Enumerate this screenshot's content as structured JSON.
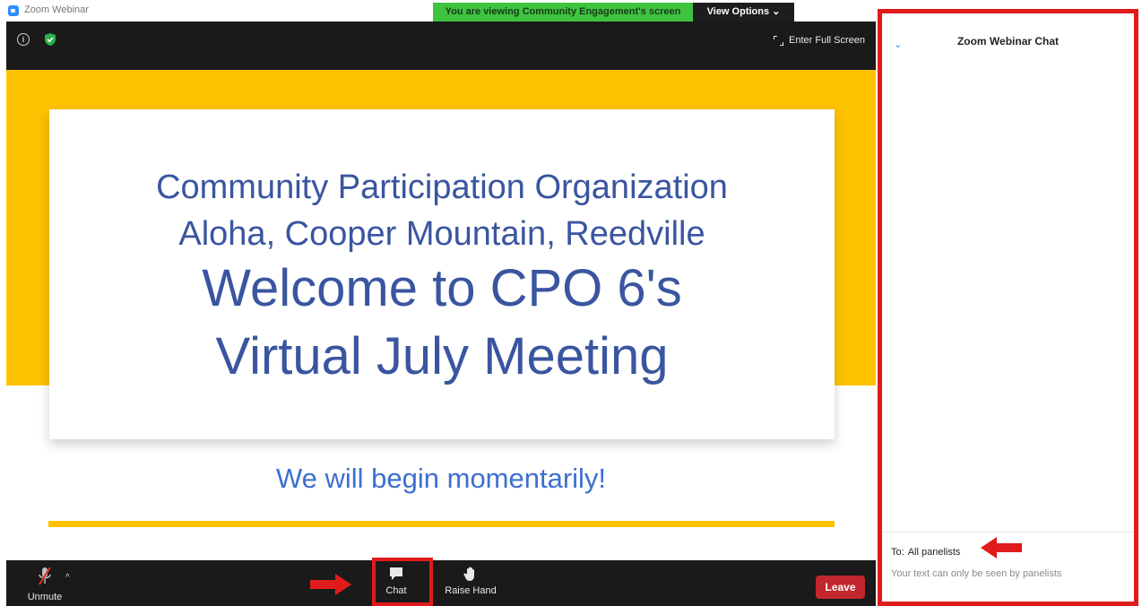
{
  "window": {
    "title": "Zoom Webinar"
  },
  "share": {
    "banner_text": "You are viewing Community Engagement's screen",
    "view_options": "View Options ⌄"
  },
  "video": {
    "fullscreen_label": "Enter Full Screen"
  },
  "slide": {
    "line1": "Community Participation Organization",
    "line2": "Aloha, Cooper Mountain, Reedville",
    "line3": "Welcome to CPO 6's",
    "line4": "Virtual July Meeting",
    "subtitle": "We will begin momentarily!"
  },
  "toolbar": {
    "unmute_label": "Unmute",
    "chat_label": "Chat",
    "raise_hand_label": "Raise Hand",
    "leave_label": "Leave"
  },
  "chat": {
    "title": "Zoom Webinar Chat",
    "to_label": "To:",
    "to_value": "All panelists",
    "input_note": "Your text can only be seen by panelists"
  },
  "colors": {
    "accent_yellow": "#fec200",
    "slide_text": "#3a55a0",
    "annotation_red": "#e01b1b",
    "leave_red": "#c2272d",
    "share_green": "#3ec43e"
  },
  "icons": [
    "app-icon",
    "info-icon",
    "shield-icon",
    "fullscreen-icon",
    "mic-muted-icon",
    "caret-up-icon",
    "chat-icon",
    "raise-hand-icon",
    "chevron-down-icon",
    "arrow-icon"
  ]
}
